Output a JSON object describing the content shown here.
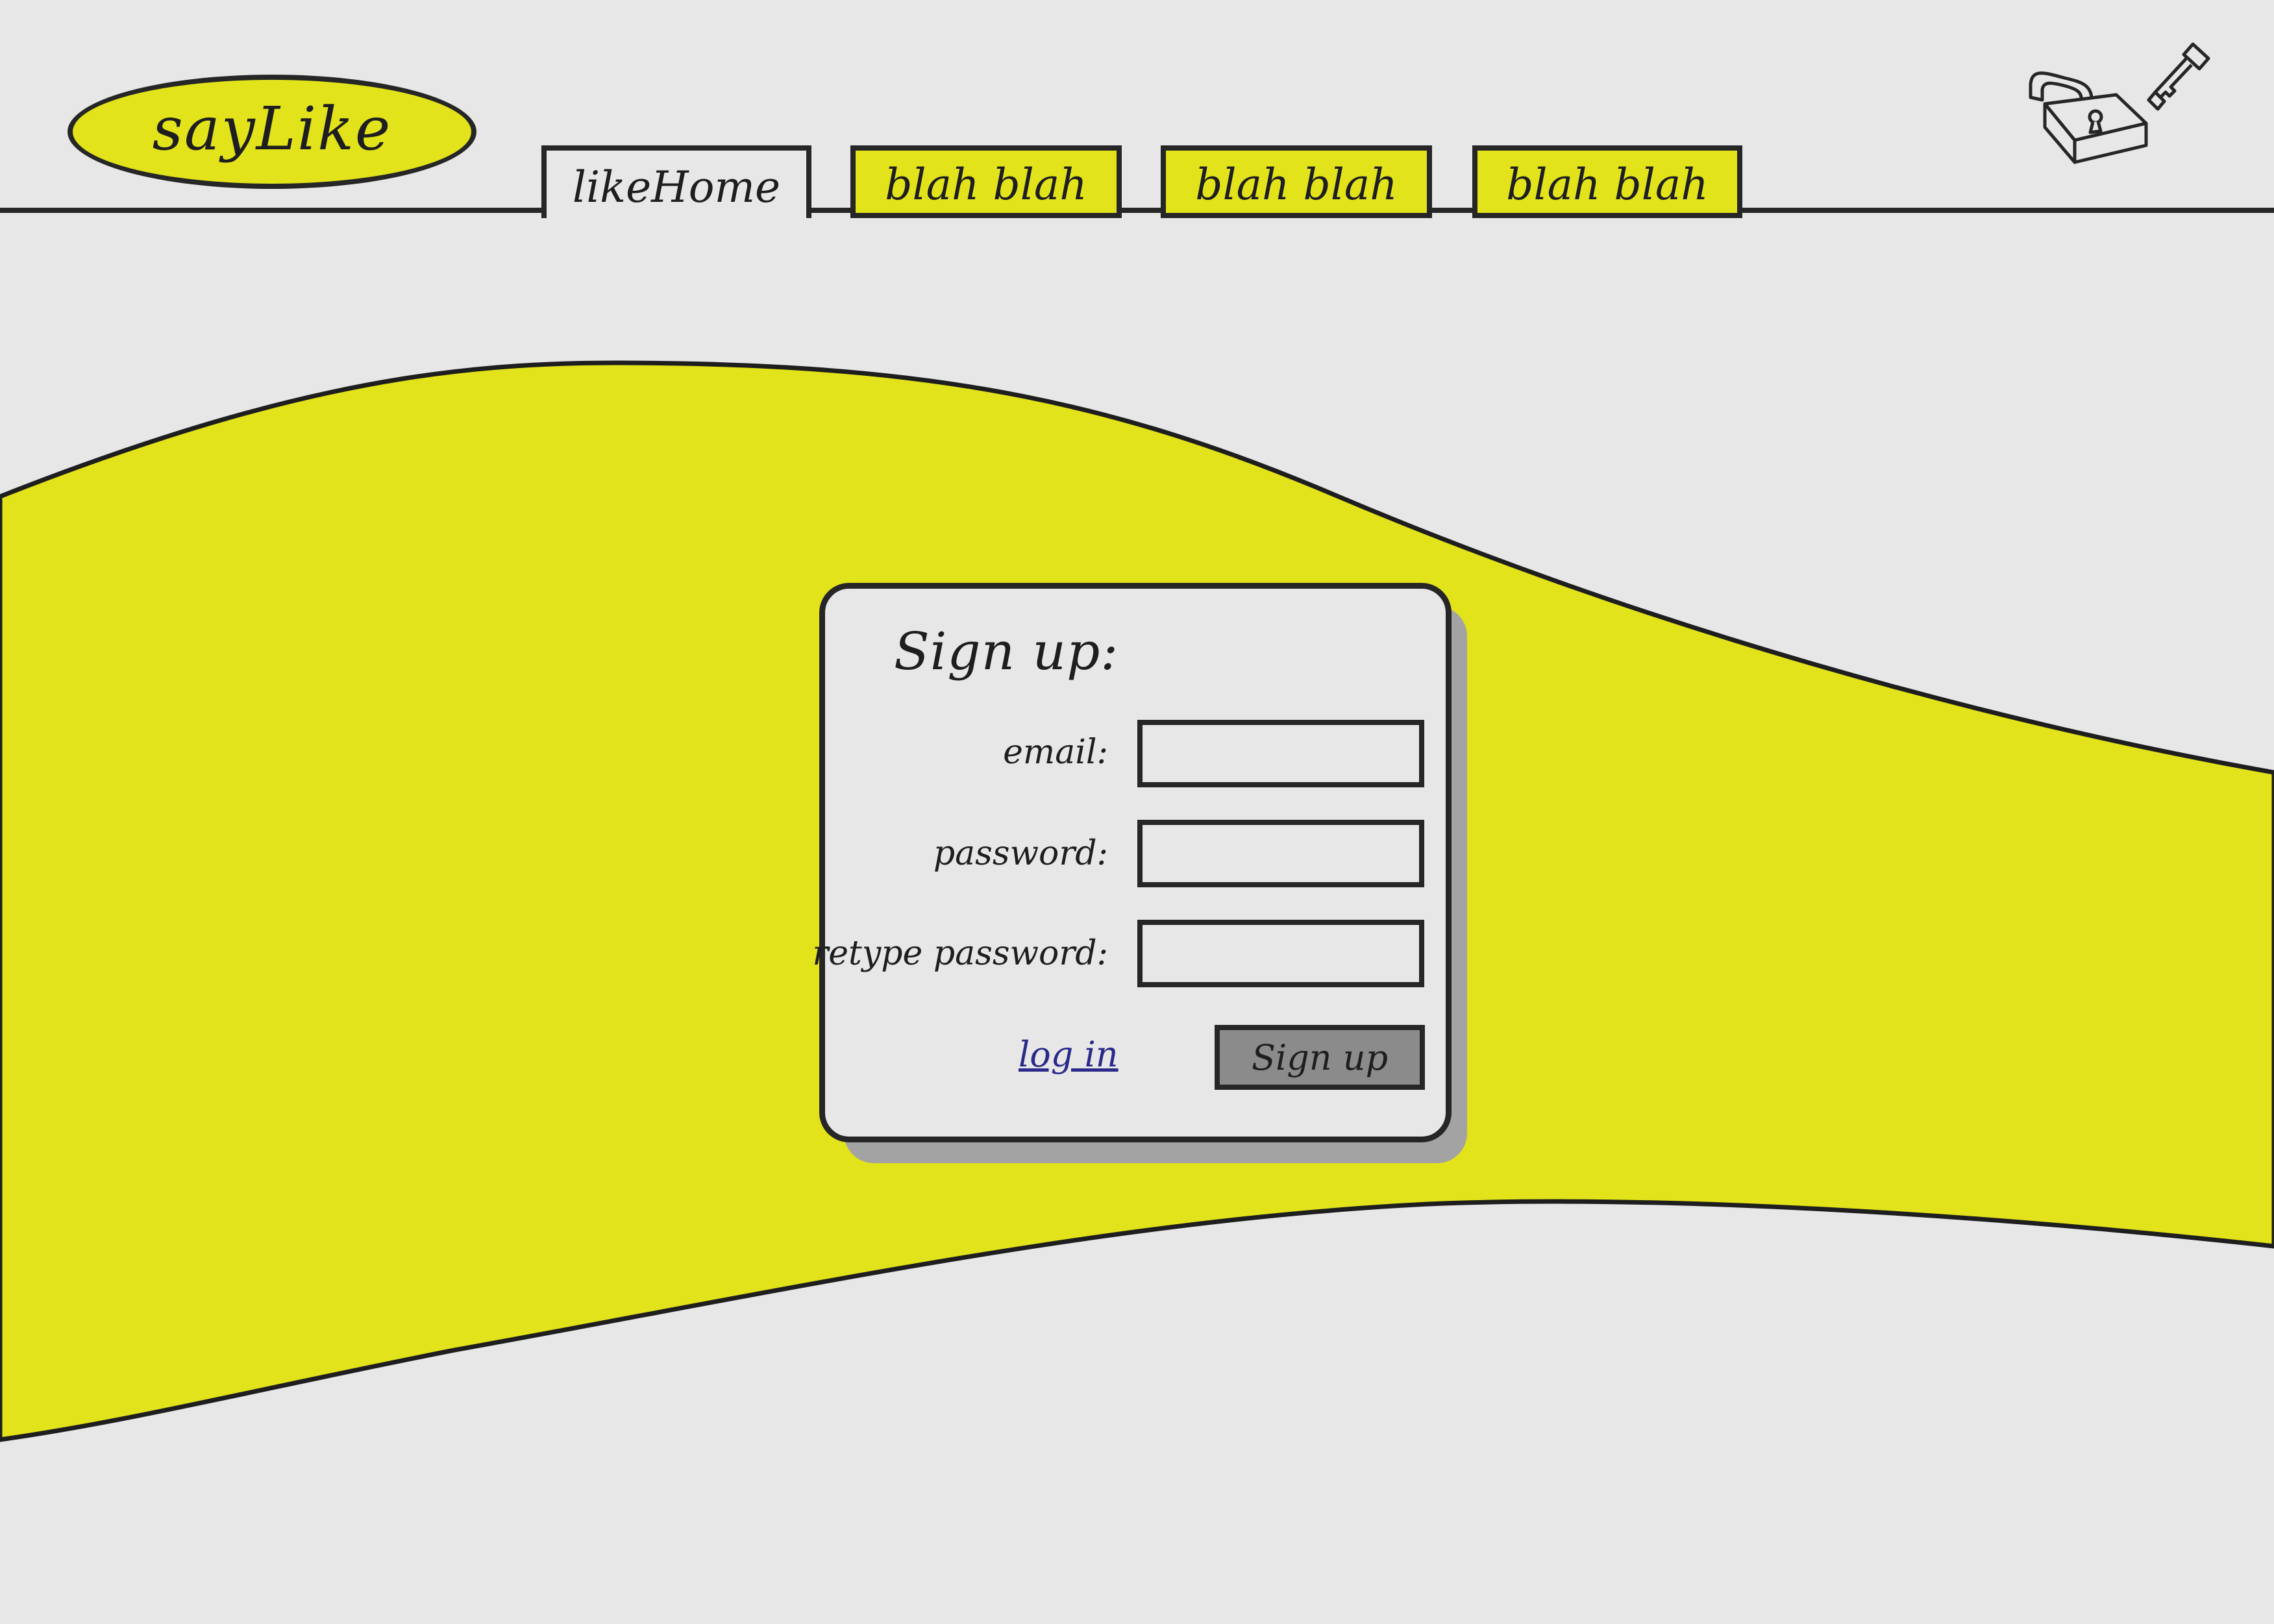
{
  "header": {
    "logo_text": "sayLike",
    "tabs": [
      {
        "label": "likeHome",
        "active": true
      },
      {
        "label": "blah blah",
        "active": false
      },
      {
        "label": "blah blah",
        "active": false
      },
      {
        "label": "blah blah",
        "active": false
      }
    ],
    "icons": [
      "lock-icon",
      "key-icon"
    ]
  },
  "signup": {
    "title": "Sign up:",
    "fields": [
      {
        "label": "email:",
        "value": "",
        "placeholder": ""
      },
      {
        "label": "password:",
        "value": "",
        "placeholder": ""
      },
      {
        "label": "retype password:",
        "value": "",
        "placeholder": ""
      }
    ],
    "login_link": "log in",
    "submit_label": "Sign up"
  },
  "colors": {
    "accent": "#e2e31a",
    "background": "#e7e7e7",
    "outline": "#262626",
    "button": "#8b8b8b",
    "link": "#2a2a8a"
  }
}
